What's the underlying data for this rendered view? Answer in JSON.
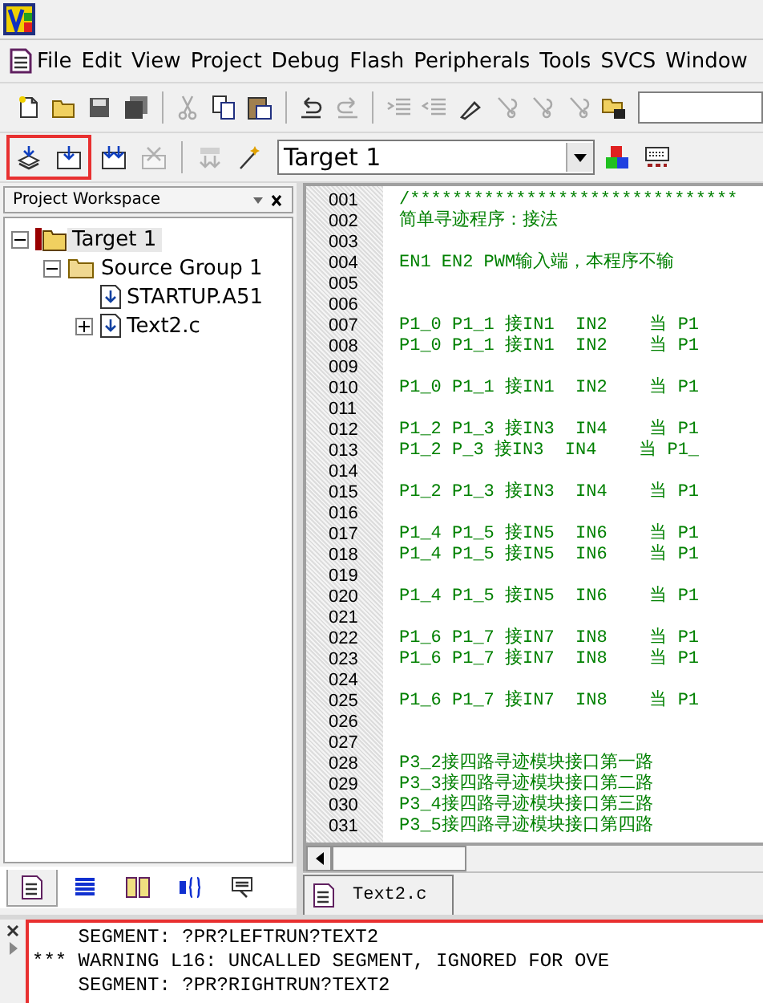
{
  "menu": [
    "File",
    "Edit",
    "View",
    "Project",
    "Debug",
    "Flash",
    "Peripherals",
    "Tools",
    "SVCS",
    "Window"
  ],
  "toolbar_1": [
    {
      "kind": "new",
      "disabled": false
    },
    {
      "kind": "open",
      "disabled": false
    },
    {
      "kind": "save",
      "disabled": false
    },
    {
      "kind": "save-all",
      "disabled": false
    },
    {
      "kind": "sep"
    },
    {
      "kind": "cut",
      "disabled": true
    },
    {
      "kind": "copy",
      "disabled": false
    },
    {
      "kind": "paste",
      "disabled": false
    },
    {
      "kind": "sep"
    },
    {
      "kind": "undo",
      "disabled": false
    },
    {
      "kind": "redo",
      "disabled": true
    },
    {
      "kind": "sep"
    },
    {
      "kind": "indent",
      "disabled": true
    },
    {
      "kind": "outdent",
      "disabled": true
    },
    {
      "kind": "bookmark",
      "disabled": false
    },
    {
      "kind": "bookmark-prev",
      "disabled": true
    },
    {
      "kind": "bookmark-next",
      "disabled": true
    },
    {
      "kind": "bookmark-clear",
      "disabled": true
    },
    {
      "kind": "find-files",
      "disabled": false
    }
  ],
  "toolbar_2": [
    {
      "kind": "translate",
      "disabled": false
    },
    {
      "kind": "build",
      "disabled": false
    },
    {
      "kind": "rebuild",
      "disabled": false
    },
    {
      "kind": "stop",
      "disabled": true
    },
    {
      "kind": "sep"
    },
    {
      "kind": "load",
      "disabled": true
    },
    {
      "kind": "wizard",
      "disabled": false
    }
  ],
  "target_select": {
    "value": "Target 1"
  },
  "workspace": {
    "title": "Project Workspace",
    "tree": [
      {
        "label": "Target 1",
        "kind": "target",
        "expanded": true,
        "selected": true,
        "children": [
          {
            "label": "Source Group 1",
            "kind": "group",
            "expanded": true,
            "selected": false,
            "children": [
              {
                "label": "STARTUP.A51",
                "kind": "file",
                "selected": false
              },
              {
                "label": "Text2.c",
                "kind": "file",
                "expanded": false,
                "selected": false
              }
            ]
          }
        ]
      }
    ],
    "tabs": [
      {
        "kind": "files",
        "selected": true
      },
      {
        "kind": "regs",
        "selected": false
      },
      {
        "kind": "books",
        "selected": false
      },
      {
        "kind": "functions",
        "selected": false
      },
      {
        "kind": "templates",
        "selected": false
      }
    ]
  },
  "editor": {
    "lines": [
      {
        "number": "001",
        "code": "/*******************************"
      },
      {
        "number": "002",
        "code": "简单寻迹程序：接法"
      },
      {
        "number": "003"
      },
      {
        "number": "004",
        "code": "EN1 EN2 PWM输入端，本程序不输"
      },
      {
        "number": "005"
      },
      {
        "number": "006"
      },
      {
        "number": "007",
        "code": "P1_0 P1_1 接IN1  IN2    当 P1"
      },
      {
        "number": "008",
        "code": "P1_0 P1_1 接IN1  IN2    当 P1"
      },
      {
        "number": "009"
      },
      {
        "number": "010",
        "code": "P1_0 P1_1 接IN1  IN2    当 P1"
      },
      {
        "number": "011"
      },
      {
        "number": "012",
        "code": "P1_2 P1_3 接IN3  IN4    当 P1"
      },
      {
        "number": "013",
        "code": "P1_2 P_3 接IN3  IN4    当 P1_"
      },
      {
        "number": "014"
      },
      {
        "number": "015",
        "code": "P1_2 P1_3 接IN3  IN4    当 P1"
      },
      {
        "number": "016"
      },
      {
        "number": "017",
        "code": "P1_4 P1_5 接IN5  IN6    当 P1"
      },
      {
        "number": "018",
        "code": "P1_4 P1_5 接IN5  IN6    当 P1"
      },
      {
        "number": "019"
      },
      {
        "number": "020",
        "code": "P1_4 P1_5 接IN5  IN6    当 P1"
      },
      {
        "number": "021"
      },
      {
        "number": "022",
        "code": "P1_6 P1_7 接IN7  IN8    当 P1"
      },
      {
        "number": "023",
        "code": "P1_6 P1_7 接IN7  IN8    当 P1"
      },
      {
        "number": "024"
      },
      {
        "number": "025",
        "code": "P1_6 P1_7 接IN7  IN8    当 P1"
      },
      {
        "number": "026"
      },
      {
        "number": "027"
      },
      {
        "number": "028",
        "code": "P3_2接四路寻迹模块接口第一路"
      },
      {
        "number": "029",
        "code": "P3_3接四路寻迹模块接口第二路"
      },
      {
        "number": "030",
        "code": "P3_4接四路寻迹模块接口第三路"
      },
      {
        "number": "031",
        "code": "P3_5接四路寻迹模块接口第四路"
      }
    ],
    "tabs": [
      {
        "label": "Text2.c",
        "selected": true
      }
    ]
  },
  "output": {
    "lines": [
      "    SEGMENT: ?PR?LEFTRUN?TEXT2",
      "*** WARNING L16: UNCALLED SEGMENT, IGNORED FOR OVE",
      "    SEGMENT: ?PR?RIGHTRUN?TEXT2"
    ]
  }
}
